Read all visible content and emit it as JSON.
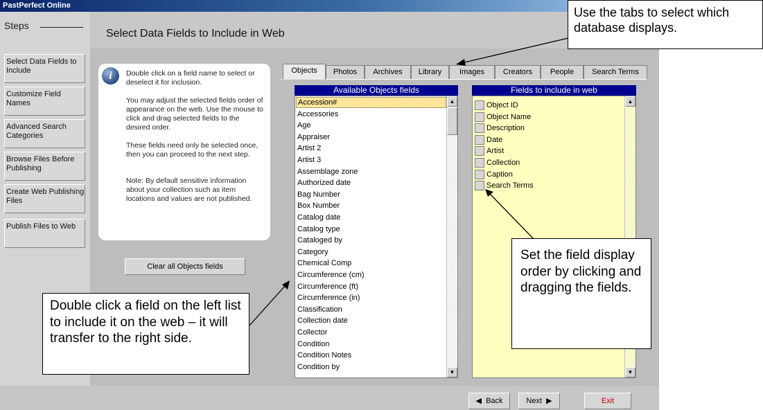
{
  "window": {
    "title": "PastPerfect Online"
  },
  "steps": {
    "heading": "Steps",
    "items": [
      {
        "label": "Select Data Fields to Include"
      },
      {
        "label": "Customize Field Names"
      },
      {
        "label": "Advanced Search Categories"
      },
      {
        "label": "Browse Files Before Publishing"
      },
      {
        "label": "Create Web Publishing Files"
      },
      {
        "label": "Publish Files to Web"
      }
    ]
  },
  "page": {
    "title": "Select Data Fields to Include in Web"
  },
  "info": {
    "icon": "info-icon",
    "p1": "Double click on a field name to select or deselect it for inclusion.",
    "p2": "You may adjust the selected fields order of appearance on the web. Use the mouse to click and drag selected fields to the desired order.",
    "p3": "These fields need only be selected once, then you can proceed to the next step.",
    "p4": "Note: By default sensitive information about your collection such as item locations and values are not published."
  },
  "clear_button": "Clear all Objects fields",
  "tabs": [
    "Objects",
    "Photos",
    "Archives",
    "Library",
    "Images",
    "Creators",
    "People",
    "Search Terms"
  ],
  "active_tab": "Objects",
  "available": {
    "header": "Available Objects fields",
    "items": [
      "Accession#",
      "Accessories",
      "Age",
      "Appraiser",
      "Artist 2",
      "Artist 3",
      "Assemblage zone",
      "Authorized date",
      "Bag Number",
      "Box Number",
      "Catalog date",
      "Catalog type",
      "Cataloged by",
      "Category",
      "Chemical Comp",
      "Circumference (cm)",
      "Circumference (ft)",
      "Circumference (in)",
      "Classification",
      "Collection date",
      "Collector",
      "Condition",
      "Condition Notes",
      "Condition by"
    ],
    "selected": "Accession#"
  },
  "included": {
    "header": "Fields to include in web",
    "items": [
      "Object ID",
      "Object Name",
      "Description",
      "Date",
      "Artist",
      "Collection",
      "Caption",
      "Search Terms"
    ]
  },
  "footer": {
    "back": "Back",
    "next": "Next",
    "exit": "Exit"
  },
  "callouts": {
    "tabs": "Use the tabs to select which database displays.",
    "order": "Set the field display order by clicking and dragging the fields.",
    "left": "Double click a field on the left list to include it on the web – it will transfer to the right side."
  },
  "colors": {
    "list_header": "#000090",
    "included_bg": "#ffffc0",
    "selected_item": "#ffe59a",
    "exit_text": "#cc0000"
  }
}
